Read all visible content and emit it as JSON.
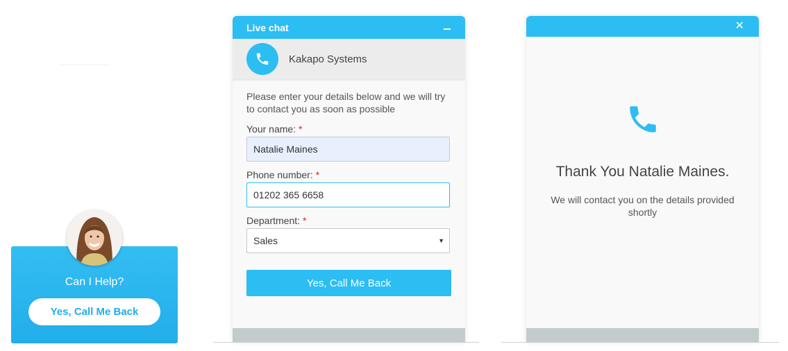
{
  "colors": {
    "accent": "#2cbdf3",
    "required_star": "#e02020",
    "footer_bar": "#c4cbcd"
  },
  "help_widget": {
    "title": "Can I Help?",
    "button_label": "Yes, Call Me Back",
    "avatar_icon": "agent-photo"
  },
  "chat": {
    "header_title": "Live chat",
    "minimize_icon": "minimize-icon",
    "company_icon": "phone-icon",
    "company_name": "Kakapo Systems",
    "intro": "Please enter your details below and we will try to contact you as soon as possible",
    "required_mark": "*",
    "name": {
      "label": "Your name:",
      "value": "Natalie Maines"
    },
    "phone": {
      "label": "Phone number:",
      "value": "01202 365 6658"
    },
    "department": {
      "label": "Department:",
      "value": "Sales"
    },
    "submit_label": "Yes, Call Me Back"
  },
  "thanks": {
    "close_icon": "close-icon",
    "phone_icon": "phone-icon",
    "title": "Thank You Natalie Maines.",
    "message": "We will contact you on the details provided shortly"
  }
}
